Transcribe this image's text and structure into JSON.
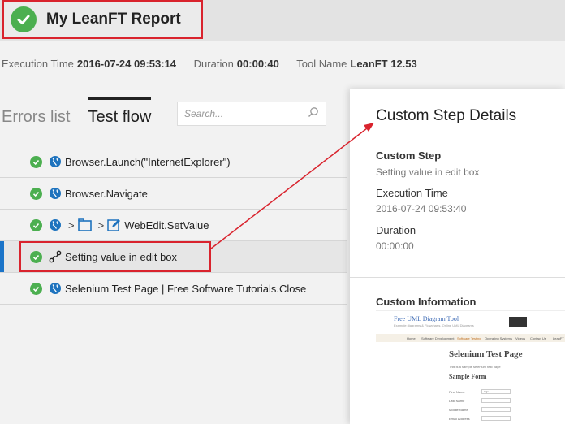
{
  "header": {
    "title": "My LeanFT Report"
  },
  "meta": {
    "execution_time_label": "Execution Time",
    "execution_time_value": "2016-07-24 09:53:14",
    "duration_label": "Duration",
    "duration_value": "00:00:40",
    "tool_name_label": "Tool Name",
    "tool_name_value": "LeanFT 12.53"
  },
  "tabs": [
    {
      "label": "Errors list",
      "active": false
    },
    {
      "label": "Test flow",
      "active": true
    }
  ],
  "search": {
    "placeholder": "Search..."
  },
  "steps": [
    {
      "object": "Browser.",
      "method": "Launch(\"InternetExplorer\")",
      "icon": "browser-globe-icon",
      "status": "passed"
    },
    {
      "object": "Browser.",
      "method": "Navigate",
      "icon": "browser-globe-icon",
      "status": "passed"
    },
    {
      "sep1": ">",
      "sep2": ">",
      "object": "WebEdit.",
      "method": "SetValue",
      "icon": "browser-globe-icon",
      "status": "passed"
    },
    {
      "text": "Setting value in edit box",
      "icon": "custom-step-icon",
      "status": "passed",
      "selected": true
    },
    {
      "text": "Selenium Test Page | Free Software Tutorials.Close",
      "icon": "browser-globe-icon",
      "status": "passed"
    }
  ],
  "details_panel": {
    "title": "Custom Step Details",
    "custom_step_label": "Custom Step",
    "custom_step_value": "Setting value in edit box",
    "execution_time_label": "Execution Time",
    "execution_time_value": "2016-07-24 09:53:40",
    "duration_label": "Duration",
    "duration_value": "00:00:00",
    "custom_info_label": "Custom Information",
    "screenshot": {
      "brand": "Free UML Diagram Tool",
      "tagline": "Example diagrams & Flowcharts, Online UML Diagrams",
      "nav": [
        "Home",
        "Software Development",
        "Software Testing",
        "Operating Systems",
        "Videos",
        "Contact Us",
        "LeanFT"
      ],
      "page_title": "Selenium Test Page",
      "page_subtitle": "This is a sample selenium test page",
      "form_title": "Sample Form",
      "fields": [
        "First Name",
        "Last Name",
        "Middle Name",
        "Email Address"
      ],
      "first_name_value": "rage"
    }
  },
  "colors": {
    "pass_green": "#4caf50",
    "highlight_red": "#d9232d",
    "selected_accent": "#1a73c8",
    "globe_blue": "#1e73be"
  }
}
